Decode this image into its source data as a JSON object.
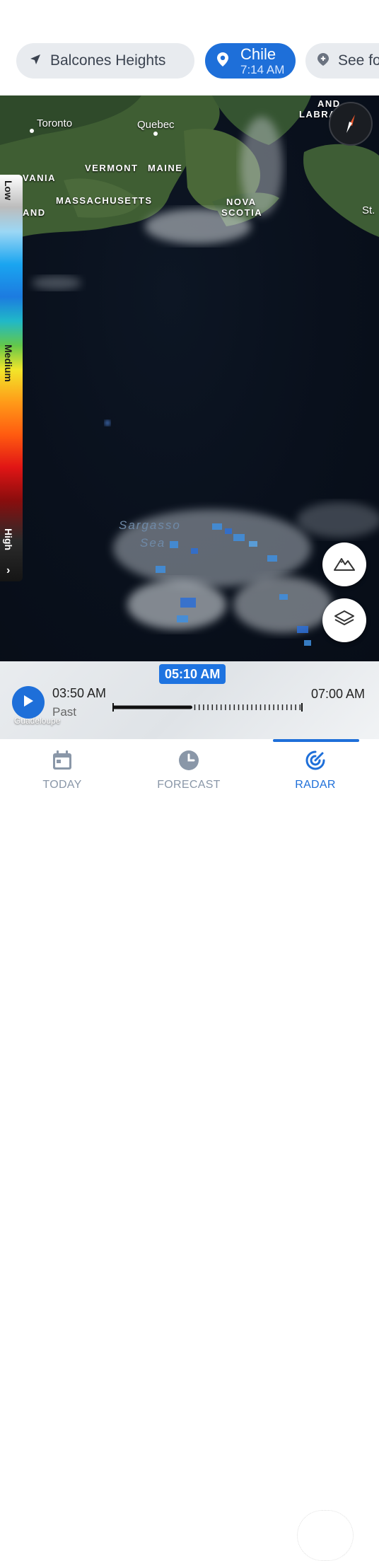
{
  "header": {
    "location_chip": {
      "icon": "navigation-arrow-icon",
      "label": "Balcones Heights"
    },
    "selected_chip": {
      "icon": "location-pin-icon",
      "name": "Chile",
      "time": "7:14 AM"
    },
    "add_chip": {
      "icon": "add-location-icon",
      "label": "See fo"
    }
  },
  "map": {
    "labels": {
      "toronto": "Toronto",
      "quebec": "Quebec",
      "vermont": "VERMONT",
      "maine": "MAINE",
      "vania": "VANIA",
      "massachusetts": "MASSACHUSETTS",
      "and_left": "AND",
      "nova": "NOVA",
      "scotia": "SCOTIA",
      "and_top": "AND",
      "labra": "LABRA",
      "st": "St.",
      "sargasso": "Sargasso",
      "sea": "Sea"
    },
    "compass_icon": "compass-icon"
  },
  "legend": {
    "low": "Low",
    "medium": "Medium",
    "high": "High",
    "expand": "›"
  },
  "controls": {
    "terrain_icon": "mountain-icon",
    "layers_icon": "layers-icon"
  },
  "timeline": {
    "current": "05:10 AM",
    "start": "03:50 AM",
    "start_sub": "Past",
    "end": "07:00 AM",
    "map_label": "Guadeloupe",
    "progress": 0.41
  },
  "nav": {
    "items": [
      {
        "label": "TODAY",
        "icon": "calendar-icon"
      },
      {
        "label": "FORECAST",
        "icon": "clock-icon"
      },
      {
        "label": "RADAR",
        "icon": "radar-icon"
      }
    ],
    "active": "RADAR"
  },
  "colors": {
    "accent": "#1e6fd9"
  }
}
